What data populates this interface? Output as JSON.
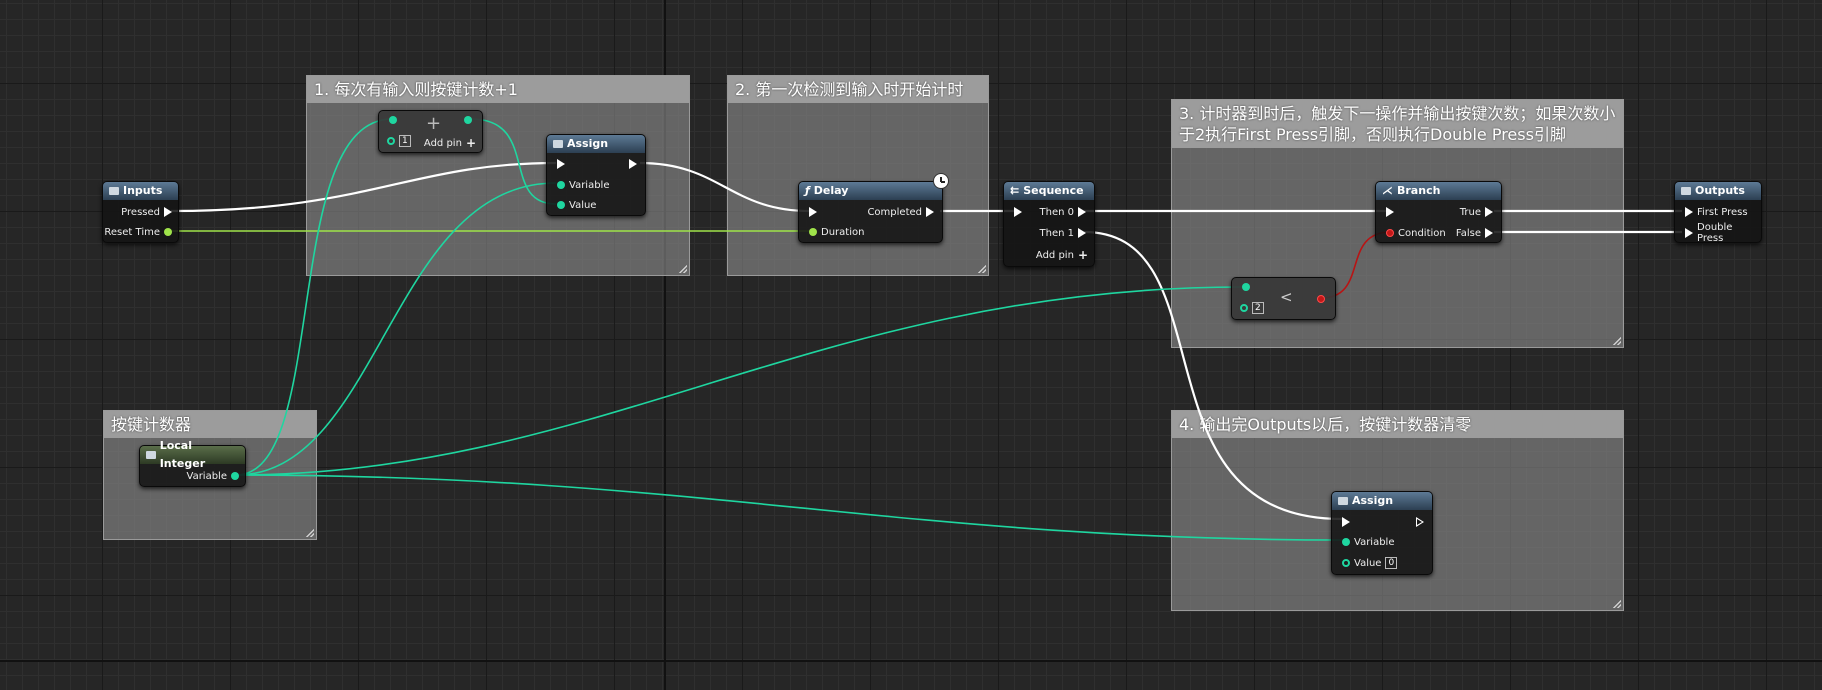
{
  "comments": {
    "c1": "1. 每次有输入则按键计数+1",
    "c2": "2. 第一次检测到输入时开始计时",
    "c3": "3. 计时器到时后，触发下一操作并输出按键次数；如果次数小于2执行First Press引脚，否则执行Double Press引脚",
    "c4": "4. 输出完Outputs以后，按键计数器清零",
    "c5": "按键计数器"
  },
  "nodes": {
    "inputs": {
      "title": "Inputs",
      "pressed": "Pressed",
      "reset_time": "Reset Time"
    },
    "add": {
      "symbol": "+",
      "value": "1",
      "add_pin": "Add pin"
    },
    "assign1": {
      "title": "Assign",
      "variable": "Variable",
      "value": "Value"
    },
    "delay": {
      "title": "Delay",
      "completed": "Completed",
      "duration": "Duration"
    },
    "sequence": {
      "title": "Sequence",
      "then0": "Then 0",
      "then1": "Then 1",
      "add_pin": "Add pin"
    },
    "branch": {
      "title": "Branch",
      "true": "True",
      "false": "False",
      "condition": "Condition"
    },
    "less": {
      "symbol": "<",
      "value": "2"
    },
    "outputs": {
      "title": "Outputs",
      "first": "First Press",
      "double": "Double Press"
    },
    "local_int": {
      "title": "Local Integer",
      "variable": "Variable"
    },
    "assign2": {
      "title": "Assign",
      "variable": "Variable",
      "value": "Value",
      "value_default": "0"
    }
  },
  "colors": {
    "exec": "#ffffff",
    "integer": "#1fd6a0",
    "float": "#9fe34a",
    "bool": "#c31818"
  }
}
